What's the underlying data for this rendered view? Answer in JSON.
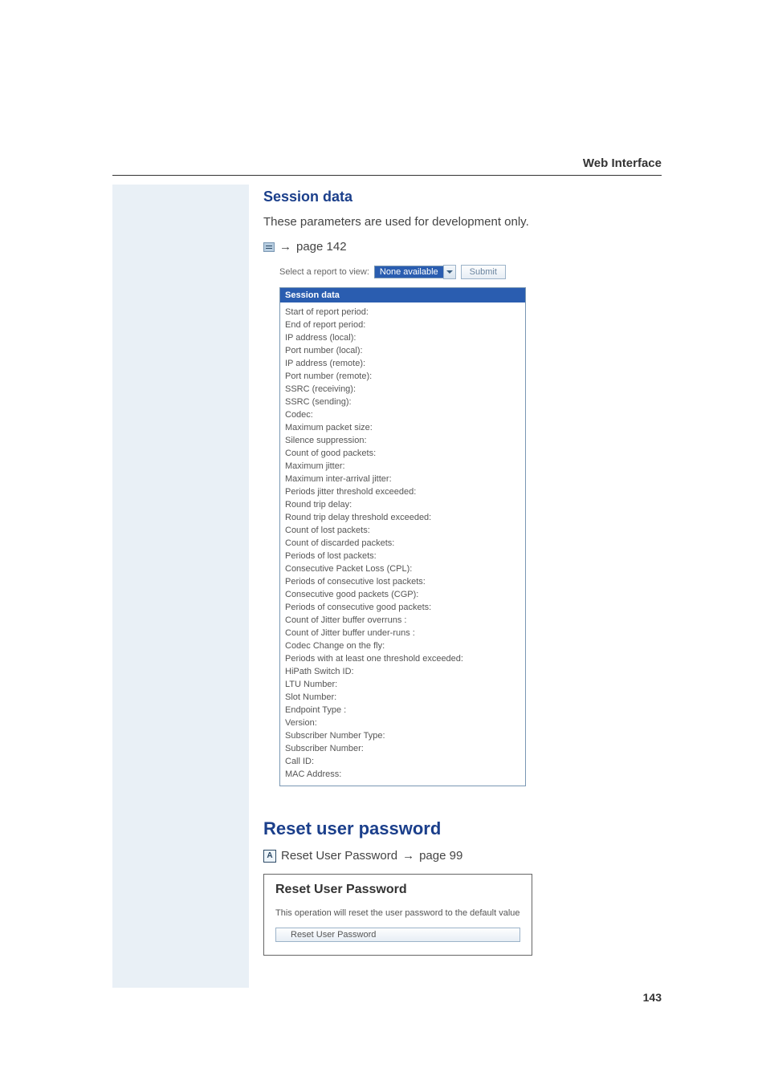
{
  "header": {
    "running_title": "Web Interface"
  },
  "session": {
    "heading": "Session data",
    "intro": "These parameters are used for development only.",
    "ref_text": "page 142",
    "select": {
      "label": "Select a report to view:",
      "value": "None available",
      "submit": "Submit"
    },
    "table_title": "Session data",
    "rows": [
      "Start of report period:",
      "End of report period:",
      "IP address (local):",
      "Port number (local):",
      "IP address (remote):",
      "Port number (remote):",
      "SSRC (receiving):",
      "SSRC (sending):",
      "Codec:",
      "Maximum packet size:",
      "Silence suppression:",
      "Count of good packets:",
      "Maximum jitter:",
      "Maximum inter-arrival jitter:",
      "Periods jitter threshold exceeded:",
      "Round trip delay:",
      "Round trip delay threshold exceeded:",
      "Count of lost packets:",
      "Count of discarded packets:",
      "Periods of lost packets:",
      "Consecutive Packet Loss (CPL):",
      "Periods of consecutive lost packets:",
      "Consecutive good packets (CGP):",
      "Periods of consecutive good packets:",
      "Count of Jitter buffer overruns :",
      "Count of Jitter buffer under-runs :",
      "Codec Change on the fly:",
      "Periods with at least one threshold exceeded:",
      "HiPath Switch ID:",
      "LTU Number:",
      "Slot Number:",
      "Endpoint Type :",
      "Version:",
      "Subscriber Number Type:",
      "Subscriber Number:",
      "Call ID:",
      "MAC Address:"
    ]
  },
  "reset": {
    "heading": "Reset user password",
    "ref_label": "Reset User Password",
    "ref_text": "page 99",
    "panel_title": "Reset User Password",
    "panel_text": "This operation will reset the user password to the default value",
    "button": "Reset User Password"
  },
  "footer": {
    "page_number": "143"
  }
}
